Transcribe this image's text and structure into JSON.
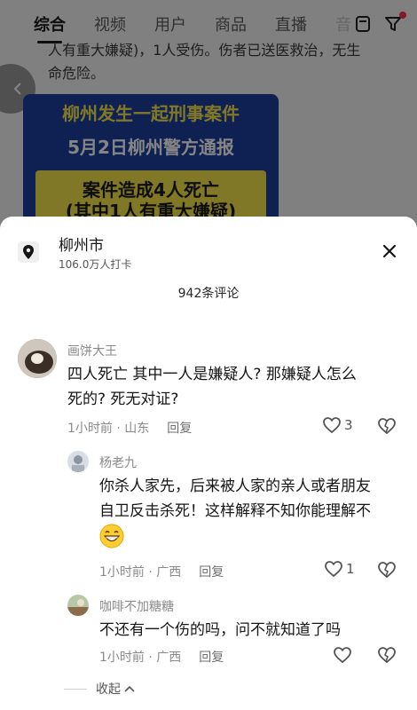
{
  "tabs": [
    {
      "label": "综合",
      "active": true
    },
    {
      "label": "视频"
    },
    {
      "label": "用户"
    },
    {
      "label": "商品"
    },
    {
      "label": "直播"
    },
    {
      "label": "音"
    }
  ],
  "icons": {
    "square": "cast-icon",
    "filter": "filter-icon",
    "back": "chevron-left-icon",
    "location": "location-pin-icon",
    "close": "close-icon",
    "like": "heart-icon",
    "dislike": "broken-heart-icon"
  },
  "article": {
    "text_line1": "人有重大嫌疑)，1人受伤。伤者已送医救治，无生",
    "text_line2": "命危险。",
    "card_title": "柳州发生一起刑事案件",
    "card_subtitle": "5月2日柳州警方通报",
    "card_box_line1": "案件造成4人死亡",
    "card_box_line2": "(其中1人有重大嫌疑)"
  },
  "sheet": {
    "location_name": "柳州市",
    "location_checkins": "106.0万人打卡",
    "comment_count": "942条评论",
    "comments": [
      {
        "user": "画饼大王",
        "text_line1": "四人死亡  其中一人是嫌疑人? 那嫌疑人怎么",
        "text_line2": "死的?  死无对证?",
        "time_loc": "1小时前 · 山东",
        "reply": "回复",
        "likes": "3"
      },
      {
        "user": "杨老九",
        "text_line1": "你杀人家先，后来被人家的亲人或者朋友",
        "text_line2": "自卫反击杀死！这样解释不知你能理解不",
        "emoji": "grin-emoji",
        "time_loc": "1小时前 · 广西",
        "reply": "回复",
        "likes": "1"
      },
      {
        "user": "咖啡不加糖糖",
        "text_line1": "不还有一个伤的吗，问不就知道了吗",
        "time_loc": "1小时前 · 广西",
        "reply": "回复",
        "likes": ""
      }
    ],
    "collapse_label": "收起"
  },
  "colors": {
    "accent": "#fe2c55",
    "card_blue": "#1d3fa0",
    "card_yellow": "#f6e44c"
  }
}
